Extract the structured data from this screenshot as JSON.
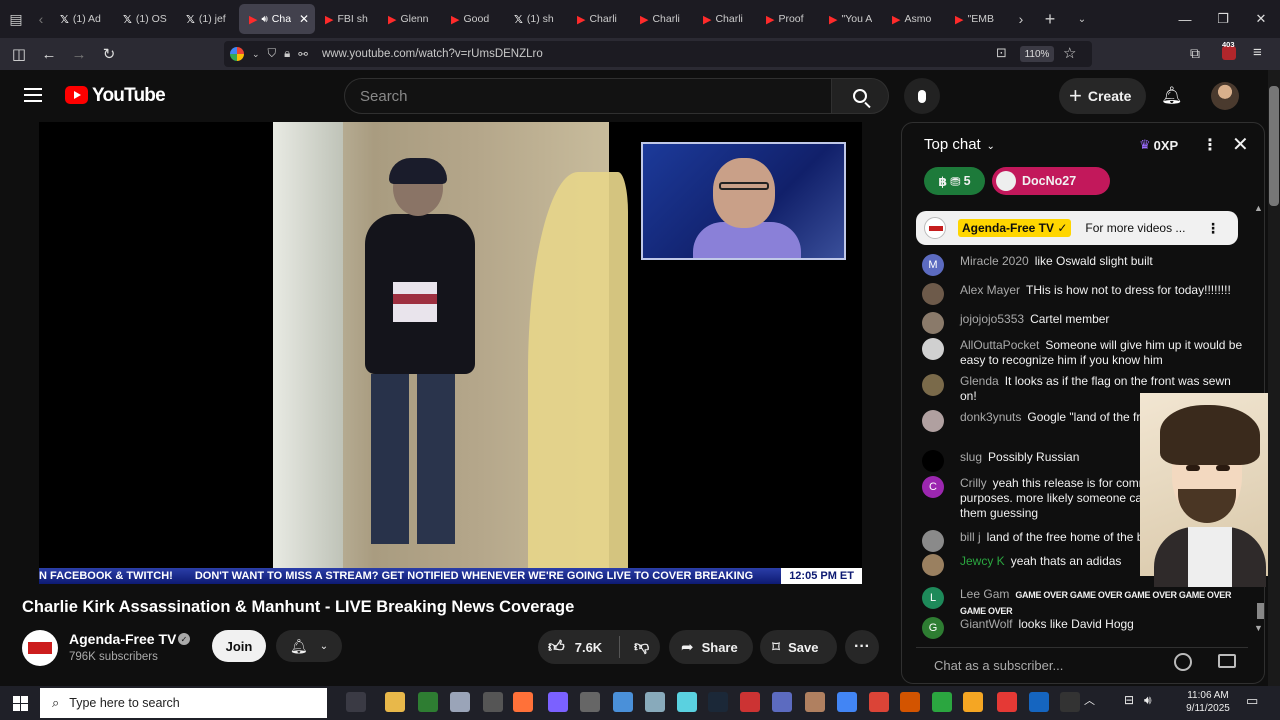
{
  "browser": {
    "tabs": [
      {
        "label": "(1) Ad",
        "favicon": "x-icon"
      },
      {
        "label": "(1) OS",
        "favicon": "x-icon"
      },
      {
        "label": "(1) jef",
        "favicon": "x-icon"
      },
      {
        "label": "Cha",
        "favicon": "youtube-icon",
        "active": true
      },
      {
        "label": "FBI sh",
        "favicon": "youtube-icon"
      },
      {
        "label": "Glenn",
        "favicon": "youtube-icon"
      },
      {
        "label": "Good",
        "favicon": "youtube-icon"
      },
      {
        "label": "(1) sh",
        "favicon": "x-icon"
      },
      {
        "label": "Charli",
        "favicon": "youtube-icon"
      },
      {
        "label": "Charli",
        "favicon": "youtube-icon"
      },
      {
        "label": "Charli",
        "favicon": "youtube-icon"
      },
      {
        "label": "Proof",
        "favicon": "youtube-icon"
      },
      {
        "label": "\"You A",
        "favicon": "youtube-icon"
      },
      {
        "label": "Asmo",
        "favicon": "youtube-icon"
      },
      {
        "label": "\"EMB",
        "favicon": "youtube-icon"
      }
    ],
    "url": "www.youtube.com/watch?v=rUmsDENZLro",
    "zoom": "110%",
    "extension_badge": "403"
  },
  "youtube": {
    "logo_text": "YouTube",
    "search_placeholder": "Search",
    "create_label": "Create"
  },
  "video": {
    "ticker_text_1": "N FACEBOOK & TWITCH!",
    "ticker_text_2": "DON'T WANT TO MISS A STREAM? GET NOTIFIED WHENEVER WE'RE GOING LIVE TO COVER BREAKING",
    "ticker_time": "12:05 PM ET",
    "title": "Charlie Kirk Assassination & Manhunt - LIVE Breaking News Coverage"
  },
  "channel": {
    "name": "Agenda-Free TV",
    "subscribers": "796K subscribers",
    "avatar_text": "AGENDA FREE",
    "join_label": "Join"
  },
  "actions": {
    "likes": "7.6K",
    "share_label": "Share",
    "save_label": "Save"
  },
  "chat": {
    "mode": "Top chat",
    "xp": "0XP",
    "gift_count": "5",
    "donor_name": "DocNo27",
    "pinned": {
      "author": "Agenda-Free TV ✓",
      "text": "For more videos ..."
    },
    "messages": [
      {
        "author": "Miracle 2020",
        "text": "like Oswald slight built",
        "initial": "M",
        "color": "#5c6bc0"
      },
      {
        "author": "Alex Mayer",
        "text": "THis is how not to dress for today!!!!!!!!",
        "initial": "",
        "color": "#6d5a4a"
      },
      {
        "author": "jojojojo5353",
        "text": "Cartel member",
        "initial": "",
        "color": "#8a7a6a"
      },
      {
        "author": "AllOuttaPocket",
        "text": "Someone will give him up it would be easy to recognize him if you know him",
        "initial": "",
        "color": "#d0d0d0"
      },
      {
        "author": "Glenda",
        "text": "It looks as if the flag on the front was sewn on!",
        "initial": "",
        "color": "#7a6a4a"
      },
      {
        "author": "donk3ynuts",
        "text": "Google \"land of the free brave shirt\"",
        "initial": "",
        "color": "#b0a0a0"
      },
      {
        "author": "slug",
        "text": "Possibly Russian",
        "initial": "",
        "color": "#000000"
      },
      {
        "author": "Crilly",
        "text": "yeah this release is for community identification purposes. more likely someone can identify him than them guessing",
        "initial": "C",
        "color": "#9c27b0"
      },
      {
        "author": "bill j",
        "text": "land of the free home of the brave",
        "initial": "",
        "color": "#8a8a8a"
      },
      {
        "author": "Jewcy K",
        "text": "yeah thats an adidas",
        "initial": "",
        "color": "#9a8060"
      },
      {
        "author": "Lee Gam",
        "text": "GAME OVER GAME OVER GAME OVER GAME OVER GAME OVER",
        "initial": "L",
        "color": "#1e8a5a"
      },
      {
        "author": "GiantWolf",
        "text": "looks like David Hogg",
        "initial": "G",
        "color": "#2e7d32"
      }
    ],
    "input_placeholder": "Chat as a subscriber..."
  },
  "taskbar": {
    "search_placeholder": "Type here to search",
    "time": "11:06 AM",
    "date": "9/11/2025"
  }
}
